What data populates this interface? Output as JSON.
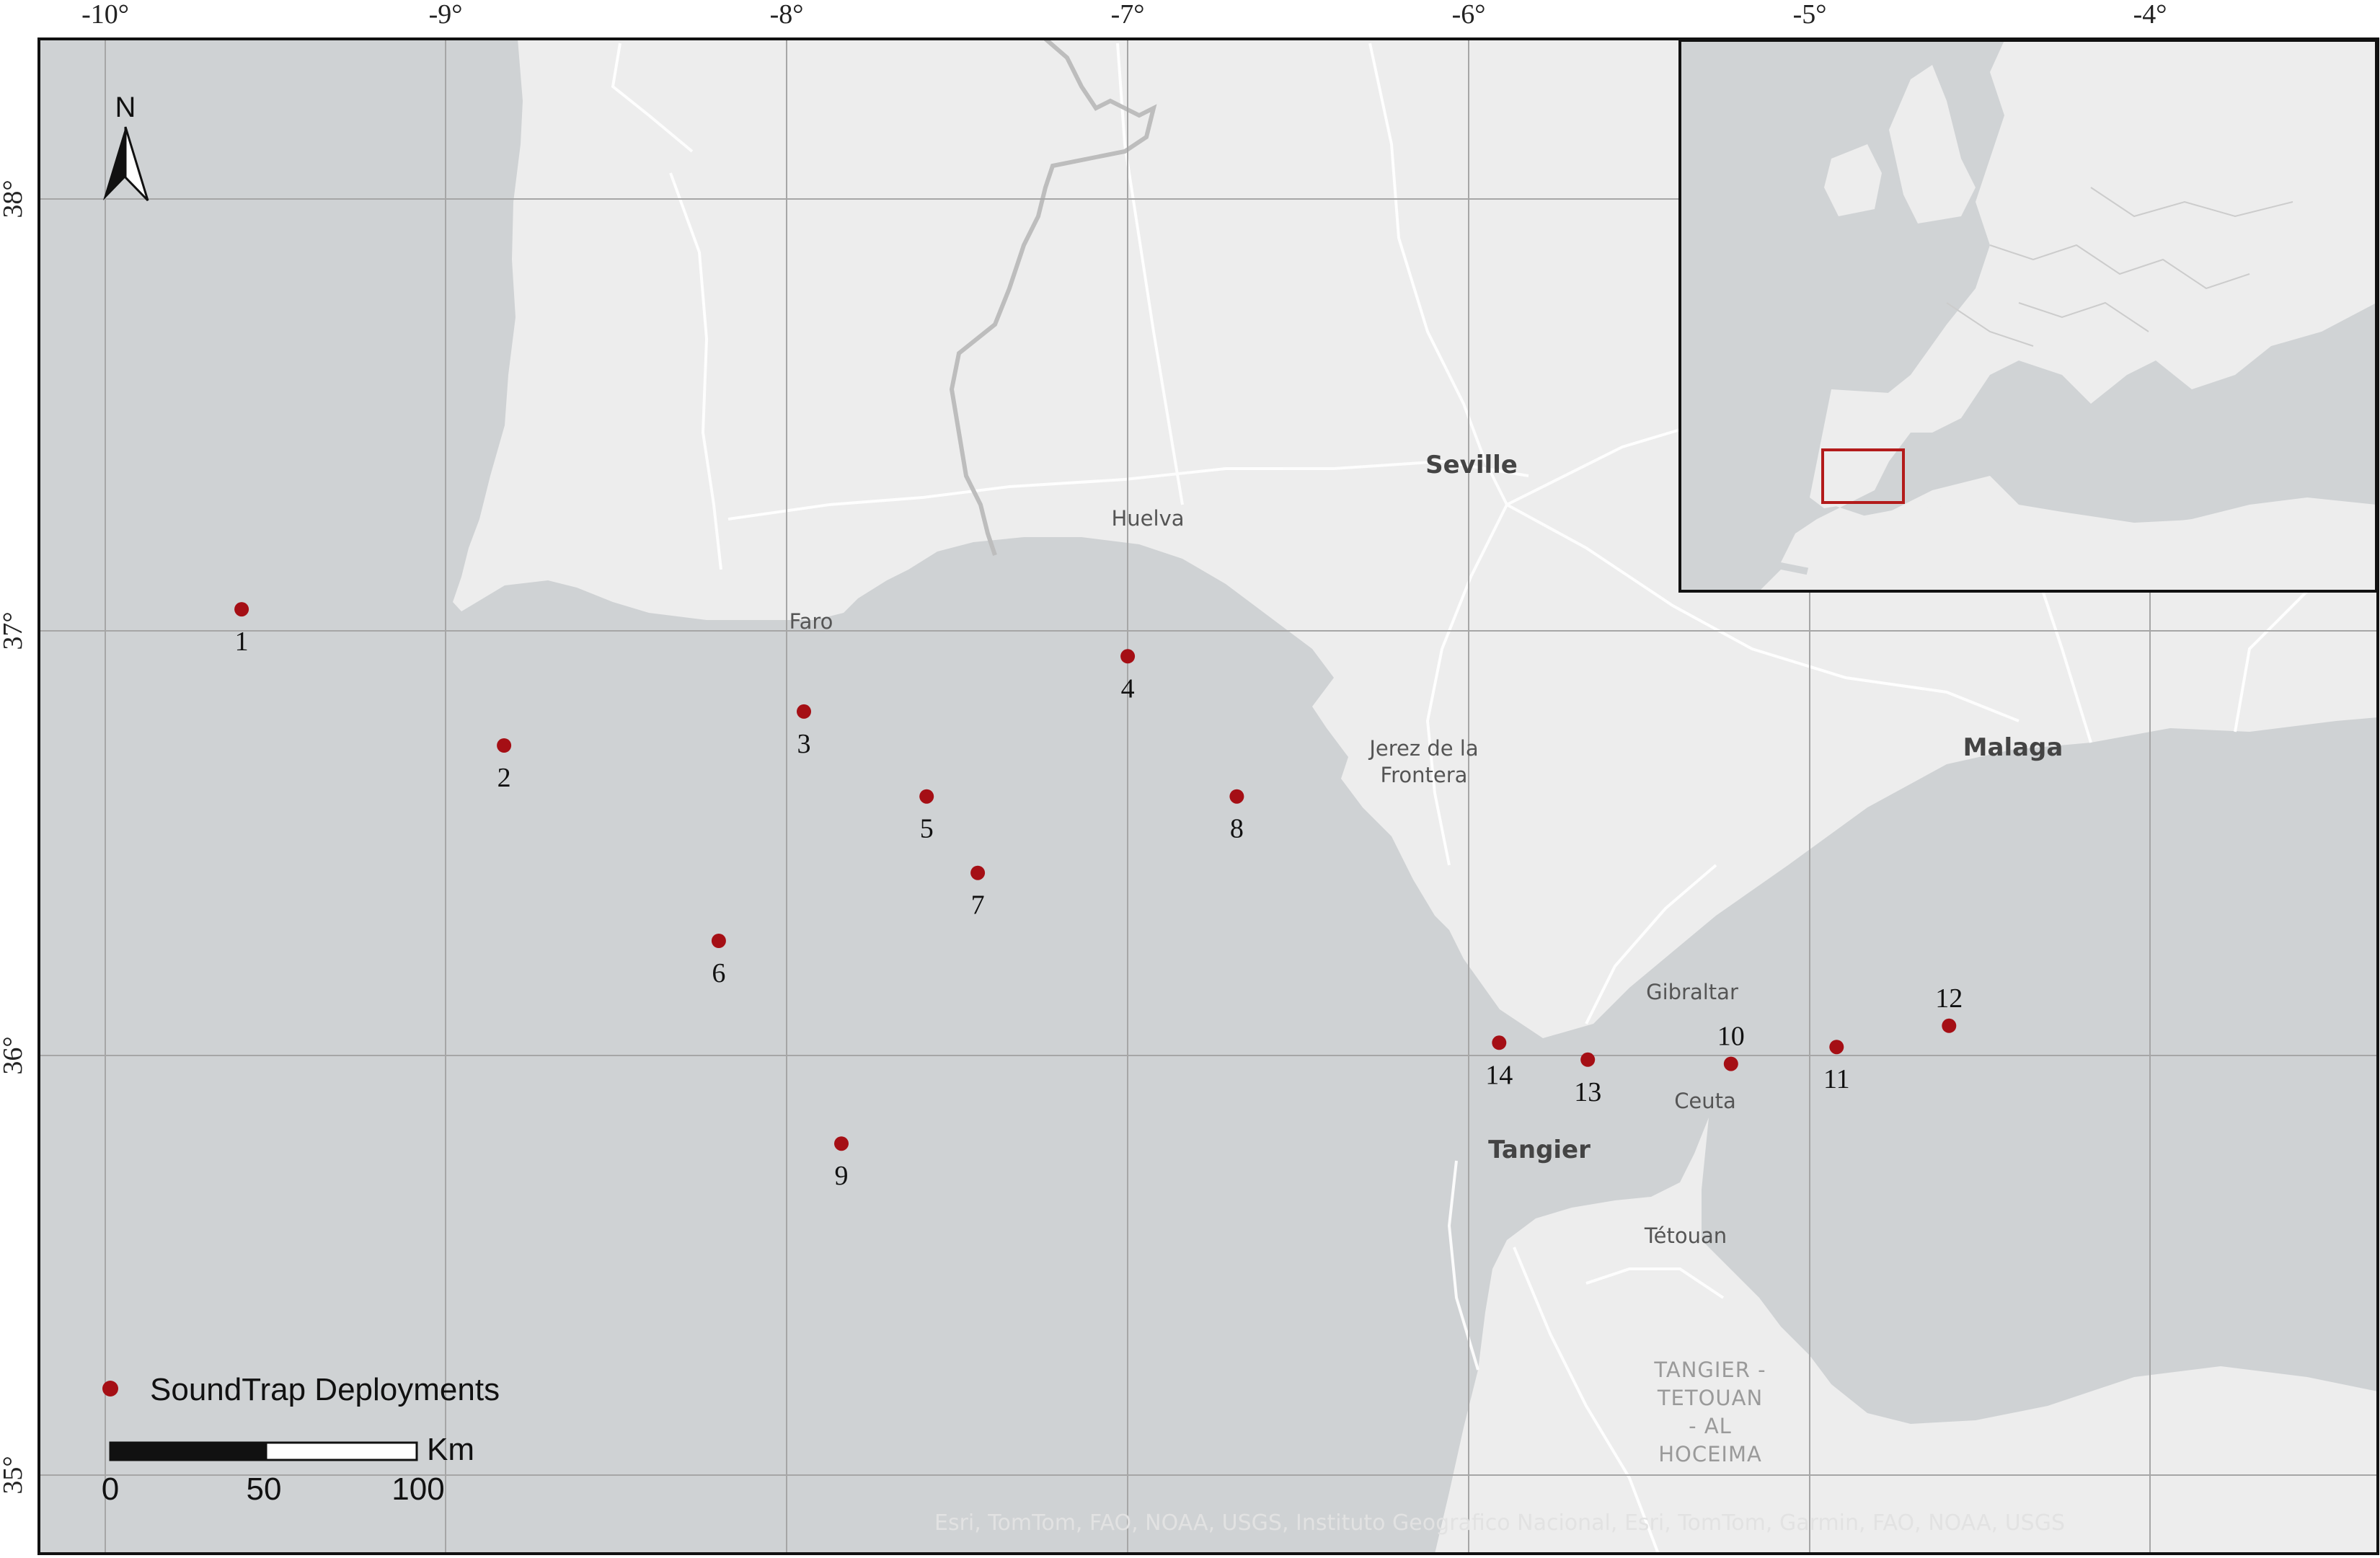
{
  "map": {
    "lon_ticks": [
      "-10°",
      "-9°",
      "-8°",
      "-7°",
      "-6°",
      "-5°",
      "-4°"
    ],
    "lat_ticks": [
      "38°",
      "37°",
      "36°",
      "35°"
    ],
    "colors": {
      "ocean": "#cfd2d4",
      "land": "#ededed",
      "roads": "#ffffff",
      "border": "#bdbdbd",
      "grid": "#a6a6a6",
      "marker": "#a50f15",
      "inset_frame": "#b31b1b"
    }
  },
  "cities": {
    "seville": "Seville",
    "huelva": "Huelva",
    "faro": "Faro",
    "jerez_line1": "Jerez de la",
    "jerez_line2": "Frontera",
    "malaga": "Malaga",
    "gibraltar": "Gibraltar",
    "ceuta": "Ceuta",
    "tangier": "Tangier",
    "tetouan": "Tétouan",
    "region_line1": "TANGIER -",
    "region_line2": "TETOUAN",
    "region_line3": "- AL",
    "region_line4": "HOCEIMA"
  },
  "deployments": [
    {
      "id": "1",
      "lon": -9.6,
      "lat": 37.05
    },
    {
      "id": "2",
      "lon": -8.83,
      "lat": 36.73
    },
    {
      "id": "3",
      "lon": -7.95,
      "lat": 36.81
    },
    {
      "id": "4",
      "lon": -7.0,
      "lat": 36.94
    },
    {
      "id": "5",
      "lon": -7.59,
      "lat": 36.61
    },
    {
      "id": "6",
      "lon": -8.2,
      "lat": 36.27
    },
    {
      "id": "7",
      "lon": -7.44,
      "lat": 36.43
    },
    {
      "id": "8",
      "lon": -6.68,
      "lat": 36.61
    },
    {
      "id": "9",
      "lon": -7.84,
      "lat": 35.79
    },
    {
      "id": "10",
      "lon": -5.23,
      "lat": 35.98
    },
    {
      "id": "11",
      "lon": -4.92,
      "lat": 36.02
    },
    {
      "id": "12",
      "lon": -4.59,
      "lat": 36.07
    },
    {
      "id": "13",
      "lon": -5.65,
      "lat": 35.99
    },
    {
      "id": "14",
      "lon": -5.91,
      "lat": 36.03
    }
  ],
  "legend": {
    "label": "SoundTrap Deployments"
  },
  "scale_bar": {
    "unit": "Km",
    "ticks": [
      "0",
      "50",
      "100"
    ]
  },
  "north_arrow": {
    "label": "N"
  },
  "attribution": "Esri, TomTom, FAO, NOAA, USGS, Instituto Geografico Nacional, Esri, TomTom, Garmin, FAO, NOAA, USGS"
}
